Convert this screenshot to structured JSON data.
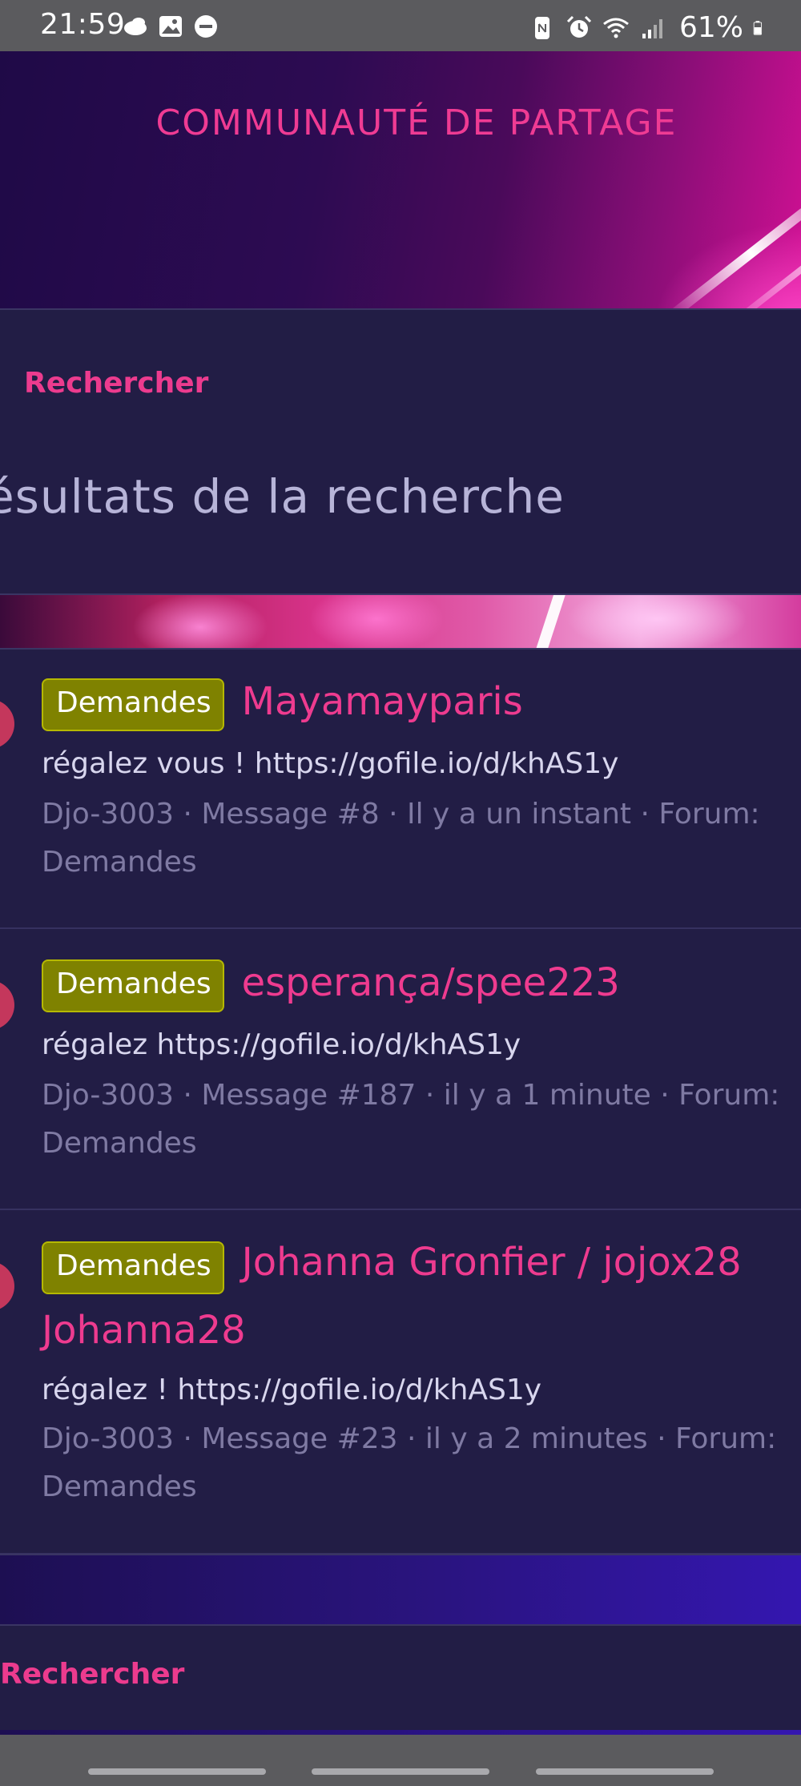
{
  "status_bar": {
    "time": "21:59",
    "left_icons": [
      "cloud-icon",
      "image-icon",
      "dnd-icon"
    ],
    "right_icons": [
      "nfc-icon",
      "alarm-icon",
      "wifi-icon",
      "signal-icon"
    ],
    "battery": "61%",
    "battery_level": 0.61
  },
  "header": {
    "title": "COMMUNAUTÉ DE PARTAGE"
  },
  "nav": {
    "search_link": "Rechercher"
  },
  "page": {
    "heading": "ésultats de la recherche"
  },
  "results": [
    {
      "badge": "Demandes",
      "title": "Mayamayparis",
      "snippet": "régalez vous ! https://gofile.io/d/khAS1y",
      "meta_line1": "Djo-3003 · Message #8 · Il y a un instant · Forum:",
      "meta_line2": "Demandes"
    },
    {
      "badge": "Demandes",
      "title": "esperança/spee223",
      "snippet": "régalez https://gofile.io/d/khAS1y",
      "meta_line1": "Djo-3003 · Message #187 · il y a 1 minute · Forum:",
      "meta_line2": "Demandes"
    },
    {
      "badge": "Demandes",
      "title_line1": "Johanna Gronfier / jojox28",
      "title_line2": "Johanna28",
      "snippet": "régalez ! https://gofile.io/d/khAS1y",
      "meta_line1": "Djo-3003 · Message #23 · il y a 2 minutes · Forum:",
      "meta_line2": "Demandes"
    }
  ],
  "footer": {
    "search_link": "Rechercher"
  },
  "colors": {
    "accent": "#ee3b8f",
    "background": "#221d45",
    "badge": "#7f8200"
  }
}
